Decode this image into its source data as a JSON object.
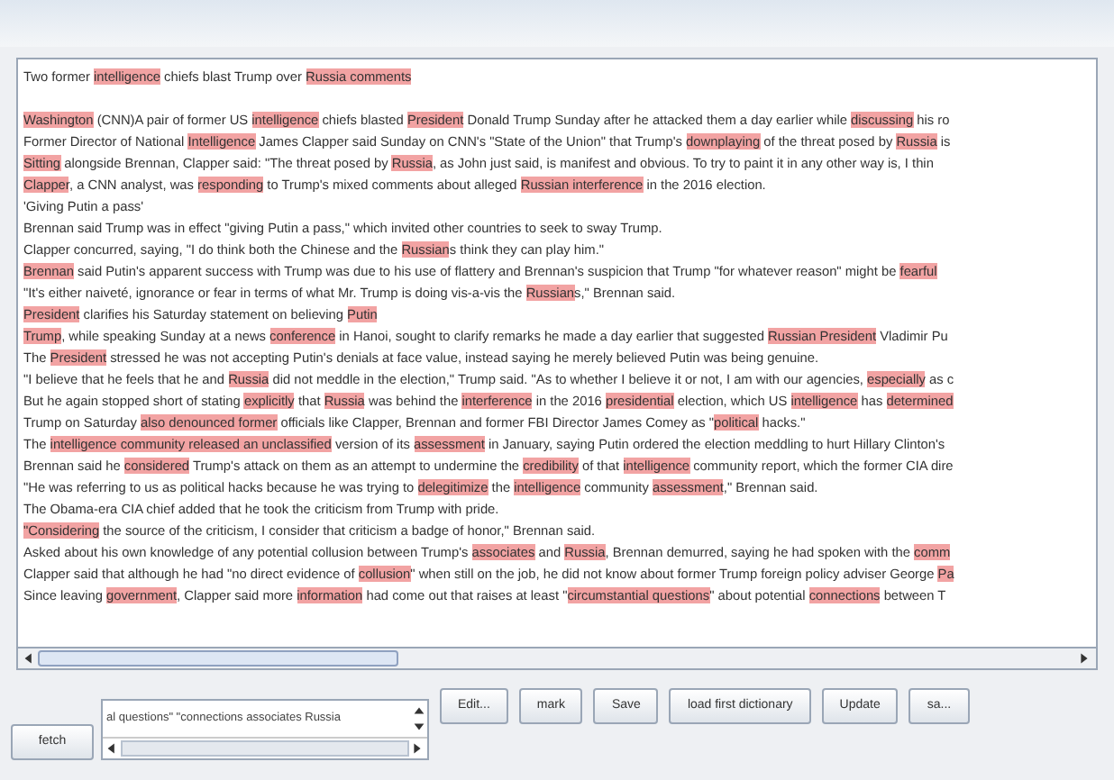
{
  "document": {
    "headline": [
      {
        "text": "Two former ",
        "highlighted": false
      },
      {
        "text": "intelligence",
        "highlighted": true
      },
      {
        "text": " chiefs blast Trump over ",
        "highlighted": false
      },
      {
        "text": "Russia comments",
        "highlighted": true
      }
    ],
    "lines": [
      {
        "segments": [
          {
            "text": "Washington",
            "highlighted": true
          },
          {
            "text": " (CNN)A pair of former US ",
            "highlighted": false
          },
          {
            "text": "intelligence",
            "highlighted": true
          },
          {
            "text": " chiefs blasted ",
            "highlighted": false
          },
          {
            "text": "President",
            "highlighted": true
          },
          {
            "text": " Donald Trump Sunday after he attacked them a day earlier while ",
            "highlighted": false
          },
          {
            "text": "discussing",
            "highlighted": true
          },
          {
            "text": " his ro",
            "highlighted": false
          }
        ]
      },
      {
        "segments": [
          {
            "text": "Former Director of National ",
            "highlighted": false
          },
          {
            "text": "Intelligence",
            "highlighted": true
          },
          {
            "text": " James Clapper said Sunday on CNN's \"State of the Union\" that Trump's ",
            "highlighted": false
          },
          {
            "text": "downplaying",
            "highlighted": true
          },
          {
            "text": " of the threat posed by ",
            "highlighted": false
          },
          {
            "text": "Russia",
            "highlighted": true
          },
          {
            "text": " is",
            "highlighted": false
          }
        ]
      },
      {
        "segments": [
          {
            "text": "Sitting",
            "highlighted": true
          },
          {
            "text": " alongside Brennan, Clapper said: \"The threat posed by ",
            "highlighted": false
          },
          {
            "text": "Russia",
            "highlighted": true
          },
          {
            "text": ", as John just said, is manifest and obvious. To try to paint it in any other way is, I thin",
            "highlighted": false
          }
        ]
      },
      {
        "segments": [
          {
            "text": "Clapper",
            "highlighted": true
          },
          {
            "text": ", a CNN analyst, was ",
            "highlighted": false
          },
          {
            "text": "responding",
            "highlighted": true
          },
          {
            "text": " to Trump's mixed comments about alleged ",
            "highlighted": false
          },
          {
            "text": "Russian interference",
            "highlighted": true
          },
          {
            "text": " in the 2016 election.",
            "highlighted": false
          }
        ]
      },
      {
        "segments": [
          {
            "text": "'Giving Putin a pass'",
            "highlighted": false
          }
        ]
      },
      {
        "segments": [
          {
            "text": "Brennan said Trump was in effect \"giving Putin a pass,\" which invited other countries to seek to sway Trump.",
            "highlighted": false
          }
        ]
      },
      {
        "segments": [
          {
            "text": "Clapper concurred, saying, \"I do think both the Chinese and the ",
            "highlighted": false
          },
          {
            "text": "Russian",
            "highlighted": true
          },
          {
            "text": "s think they can play him.\"",
            "highlighted": false
          }
        ]
      },
      {
        "segments": [
          {
            "text": "Brennan",
            "highlighted": true
          },
          {
            "text": " said Putin's apparent success with Trump was due to his use of flattery and Brennan's suspicion that Trump \"for whatever reason\" might be ",
            "highlighted": false
          },
          {
            "text": "fearful",
            "highlighted": true
          }
        ]
      },
      {
        "segments": [
          {
            "text": "\"It's either naiveté, ignorance or fear in terms of what Mr. Trump is doing vis-a-vis the ",
            "highlighted": false
          },
          {
            "text": "Russian",
            "highlighted": true
          },
          {
            "text": "s,\" Brennan said.",
            "highlighted": false
          }
        ]
      },
      {
        "segments": [
          {
            "text": "President",
            "highlighted": true
          },
          {
            "text": " clarifies his Saturday statement on believing ",
            "highlighted": false
          },
          {
            "text": "Putin",
            "highlighted": true
          }
        ]
      },
      {
        "segments": [
          {
            "text": "Trump",
            "highlighted": true
          },
          {
            "text": ", while speaking Sunday at a news ",
            "highlighted": false
          },
          {
            "text": "conference",
            "highlighted": true
          },
          {
            "text": " in Hanoi, sought to clarify remarks he made a day earlier that suggested ",
            "highlighted": false
          },
          {
            "text": "Russian",
            "highlighted": true
          },
          {
            "text": " President",
            "highlighted": true
          },
          {
            "text": " Vladimir Pu",
            "highlighted": false
          }
        ]
      },
      {
        "segments": [
          {
            "text": "The ",
            "highlighted": false
          },
          {
            "text": "President",
            "highlighted": true
          },
          {
            "text": " stressed he was not accepting Putin's denials at face value, instead saying he merely believed Putin was being genuine.",
            "highlighted": false
          }
        ]
      },
      {
        "segments": [
          {
            "text": "\"I believe that he feels that he and ",
            "highlighted": false
          },
          {
            "text": "Russia",
            "highlighted": true
          },
          {
            "text": " did not meddle in the election,\" Trump said. \"As to whether I believe it or not, I am with our agencies, ",
            "highlighted": false
          },
          {
            "text": "especially",
            "highlighted": true
          },
          {
            "text": " as c",
            "highlighted": false
          }
        ]
      },
      {
        "segments": [
          {
            "text": "But he again stopped short of stating ",
            "highlighted": false
          },
          {
            "text": "explicitly",
            "highlighted": true
          },
          {
            "text": " that ",
            "highlighted": false
          },
          {
            "text": "Russia",
            "highlighted": true
          },
          {
            "text": " was behind the ",
            "highlighted": false
          },
          {
            "text": "interference",
            "highlighted": true
          },
          {
            "text": " in the 2016 ",
            "highlighted": false
          },
          {
            "text": "presidential",
            "highlighted": true
          },
          {
            "text": " election, which US ",
            "highlighted": false
          },
          {
            "text": "intelligence",
            "highlighted": true
          },
          {
            "text": " has ",
            "highlighted": false
          },
          {
            "text": "determined",
            "highlighted": true
          }
        ]
      },
      {
        "segments": [
          {
            "text": "Trump on Saturday ",
            "highlighted": false
          },
          {
            "text": "also denounced former",
            "highlighted": true
          },
          {
            "text": " officials like Clapper, Brennan and former FBI Director James Comey as \"",
            "highlighted": false
          },
          {
            "text": "political",
            "highlighted": true
          },
          {
            "text": " hacks.\"",
            "highlighted": false
          }
        ]
      },
      {
        "segments": [
          {
            "text": "The ",
            "highlighted": false
          },
          {
            "text": "intelligence community released an unclassified",
            "highlighted": true
          },
          {
            "text": " version of its ",
            "highlighted": false
          },
          {
            "text": "assessment",
            "highlighted": true
          },
          {
            "text": " in January, saying Putin ordered the election meddling to hurt Hillary Clinton's",
            "highlighted": false
          }
        ]
      },
      {
        "segments": [
          {
            "text": "Brennan said he ",
            "highlighted": false
          },
          {
            "text": "considered",
            "highlighted": true
          },
          {
            "text": " Trump's attack on them as an attempt to undermine the ",
            "highlighted": false
          },
          {
            "text": "credibility",
            "highlighted": true
          },
          {
            "text": " of that ",
            "highlighted": false
          },
          {
            "text": "intelligence",
            "highlighted": true
          },
          {
            "text": " community report, which the former CIA dire",
            "highlighted": false
          }
        ]
      },
      {
        "segments": [
          {
            "text": "\"He was referring to us as political hacks because he was trying to ",
            "highlighted": false
          },
          {
            "text": "delegitimize",
            "highlighted": true
          },
          {
            "text": " the ",
            "highlighted": false
          },
          {
            "text": "intelligence",
            "highlighted": true
          },
          {
            "text": " community ",
            "highlighted": false
          },
          {
            "text": "assessment",
            "highlighted": true
          },
          {
            "text": ",\" Brennan said.",
            "highlighted": false
          }
        ]
      },
      {
        "segments": [
          {
            "text": "The Obama-era CIA chief added that he took the criticism from Trump with pride.",
            "highlighted": false
          }
        ]
      },
      {
        "segments": [
          {
            "text": "\"Considering",
            "highlighted": true
          },
          {
            "text": " the source of the criticism, I consider that criticism a badge of honor,\" Brennan said.",
            "highlighted": false
          }
        ]
      },
      {
        "segments": [
          {
            "text": "Asked about his own knowledge of any potential collusion between Trump's ",
            "highlighted": false
          },
          {
            "text": "associates",
            "highlighted": true
          },
          {
            "text": " and ",
            "highlighted": false
          },
          {
            "text": "Russia",
            "highlighted": true
          },
          {
            "text": ", Brennan demurred, saying he had spoken with the ",
            "highlighted": false
          },
          {
            "text": "comm",
            "highlighted": true
          }
        ]
      },
      {
        "segments": [
          {
            "text": "Clapper said that although he had \"no direct evidence of ",
            "highlighted": false
          },
          {
            "text": "collusion",
            "highlighted": true
          },
          {
            "text": "\" when still on the job, he did not know about former Trump foreign policy adviser George ",
            "highlighted": false
          },
          {
            "text": "Pa",
            "highlighted": true
          }
        ]
      },
      {
        "segments": [
          {
            "text": "Since leaving ",
            "highlighted": false
          },
          {
            "text": "government",
            "highlighted": true
          },
          {
            "text": ", Clapper said more ",
            "highlighted": false
          },
          {
            "text": "information",
            "highlighted": true
          },
          {
            "text": " had come out that raises at least \"",
            "highlighted": false
          },
          {
            "text": "circumstantial questions",
            "highlighted": true
          },
          {
            "text": "\" about potential ",
            "highlighted": false
          },
          {
            "text": "connections",
            "highlighted": true
          },
          {
            "text": " between T",
            "highlighted": false
          }
        ]
      }
    ]
  },
  "fetch_button": "fetch",
  "keyword_list": [
    "al questions\" \"connections associates Russia"
  ],
  "buttons": [
    "Edit...",
    "mark",
    "Save",
    "load first dictionary",
    "Update",
    "sa..."
  ]
}
